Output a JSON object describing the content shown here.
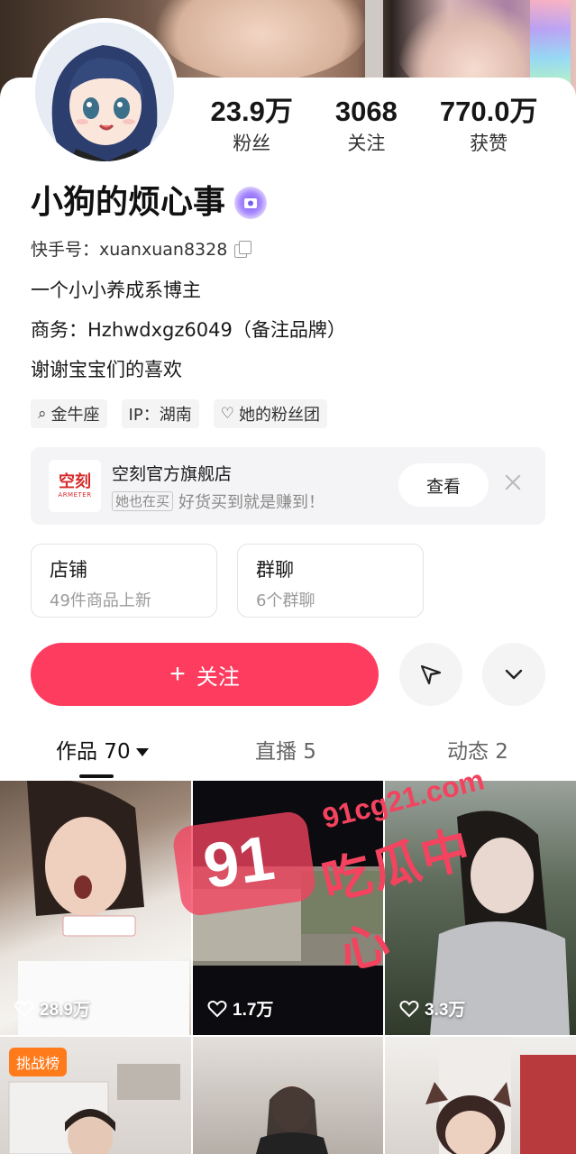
{
  "profile": {
    "name": "小狗的烦心事",
    "account_id": "快手号：xuanxuan8328",
    "bio": [
      "一个小小养成系博主",
      "商务：Hzhwdxgz6049（备注品牌）",
      "谢谢宝宝们的喜欢"
    ]
  },
  "stats": [
    {
      "num": "23.9万",
      "label": "粉丝"
    },
    {
      "num": "3068",
      "label": "关注"
    },
    {
      "num": "770.0万",
      "label": "获赞"
    }
  ],
  "tags": [
    {
      "icon": "search-icon",
      "glyph": "⌕",
      "label": "金牛座"
    },
    {
      "icon": "",
      "glyph": "",
      "label": "IP：湖南"
    },
    {
      "icon": "heart-outline-icon",
      "glyph": "♡",
      "label": "她的粉丝团"
    }
  ],
  "shop_ad": {
    "logo_text": "空刻",
    "logo_sub": "ARMETER",
    "name": "空刻官方旗舰店",
    "badge": "她也在买",
    "slogan": "好货买到就是赚到！",
    "view_label": "查看"
  },
  "entries": [
    {
      "title": "店铺",
      "sub": "49件商品上新"
    },
    {
      "title": "群聊",
      "sub": "6个群聊"
    }
  ],
  "actions": {
    "follow_label": "关注"
  },
  "tabs": [
    {
      "label": "作品 70"
    },
    {
      "label": "直播 5"
    },
    {
      "label": "动态 2"
    }
  ],
  "videos": [
    {
      "likes": "28.9万"
    },
    {
      "likes": "1.7万"
    },
    {
      "likes": "3.3万"
    },
    {
      "badge": "挑战榜"
    },
    {},
    {}
  ],
  "watermark": {
    "num": "91",
    "url": "91cg21.com",
    "text": "吃瓜中心"
  },
  "colors": {
    "accent": "#fe3c5f",
    "badge_purple": "#7b5cf0",
    "challenge_orange": "#ff7a1a"
  }
}
